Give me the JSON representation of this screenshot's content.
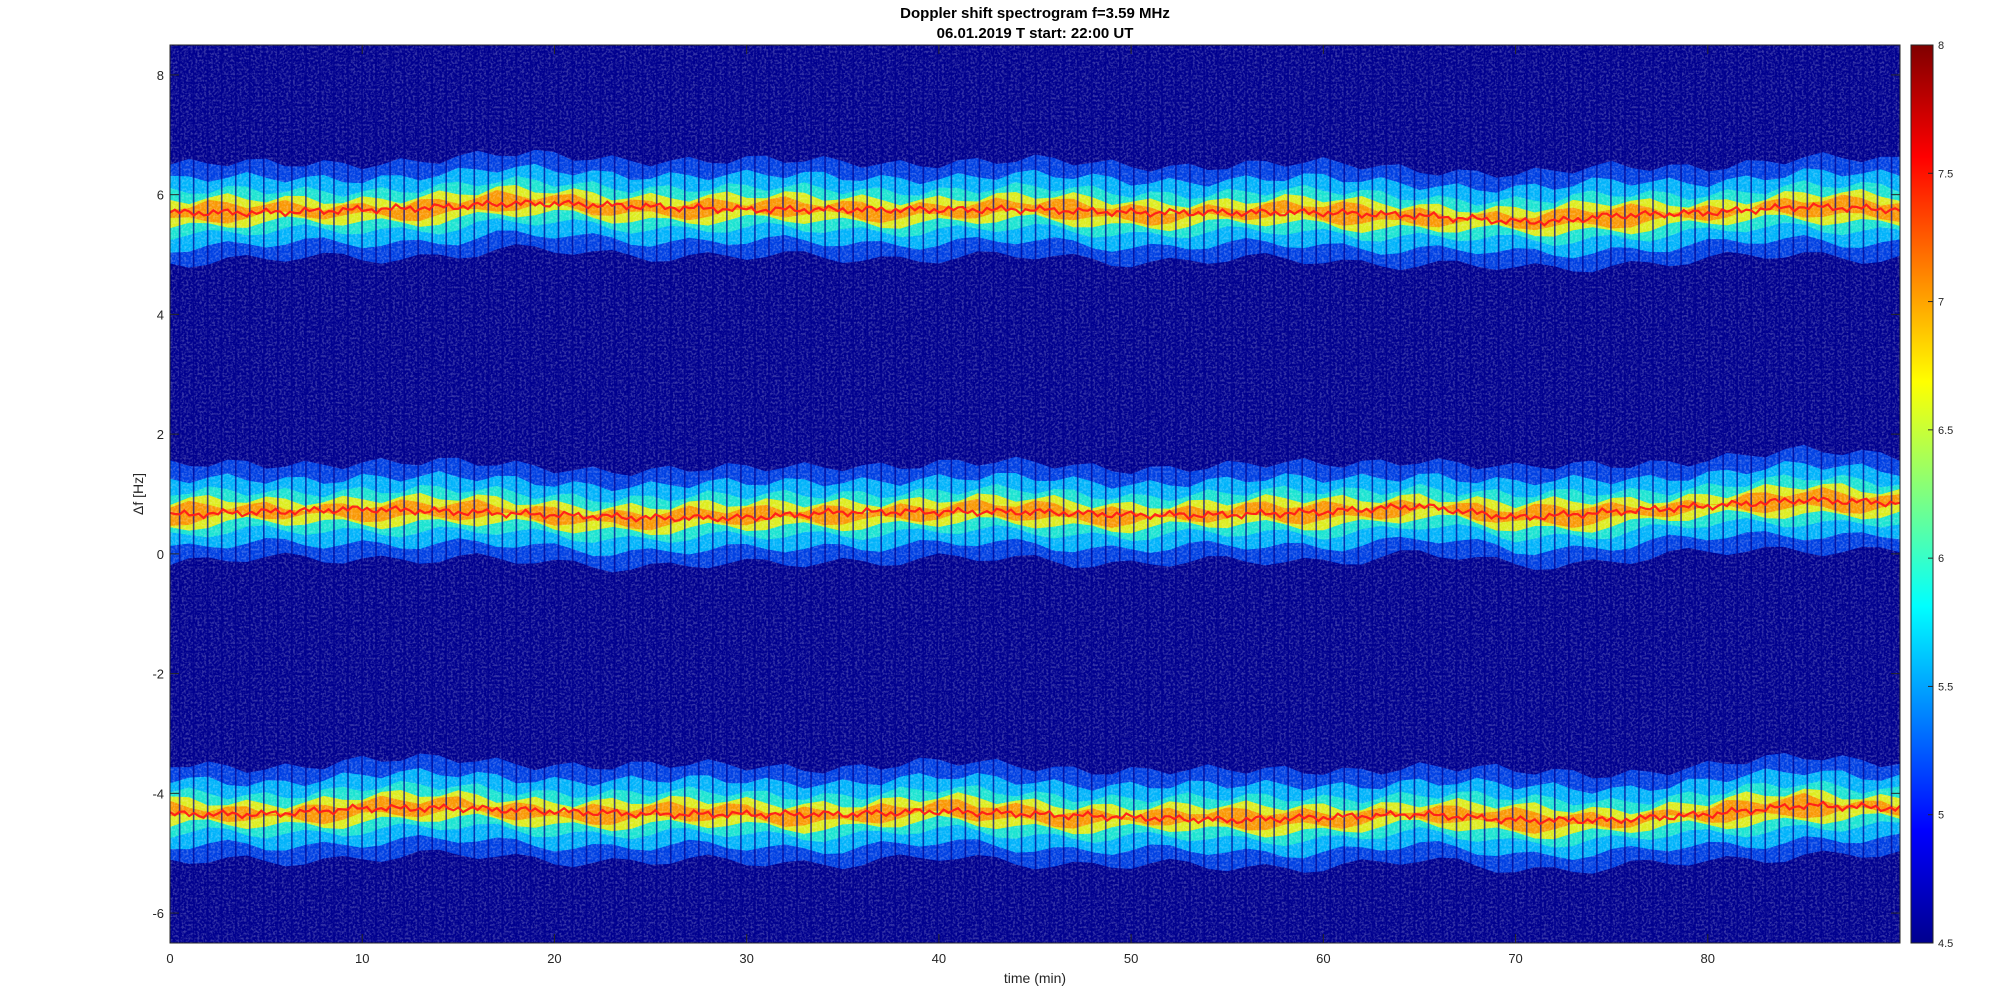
{
  "chart_data": {
    "type": "heatmap",
    "title": "Doppler shift spectrogram f=3.59 MHz",
    "subtitle": "06.01.2019   T start: 22:00 UT",
    "xlabel": "time (min)",
    "ylabel": "Δf [Hz]",
    "xlim": [
      0,
      90
    ],
    "ylim": [
      -6.5,
      8.5
    ],
    "x_ticks": [
      "0",
      "10",
      "20",
      "30",
      "40",
      "50",
      "60",
      "70",
      "80"
    ],
    "y_ticks": [
      "8",
      "6",
      "4",
      "2",
      "0",
      "-2",
      "-4",
      "-6"
    ],
    "colorbar": {
      "range": [
        4.5,
        8
      ],
      "colormap": "jet",
      "ticks": [
        "8",
        "7.5",
        "7",
        "6.5",
        "6",
        "5.5",
        "5",
        "4.5"
      ]
    },
    "series": [
      {
        "time_min": [
          0,
          5,
          10,
          15,
          17,
          20,
          25,
          30,
          35,
          40,
          45,
          50,
          55,
          60,
          65,
          70,
          72,
          75,
          80,
          85,
          90
        ],
        "df_hz": [
          5.7,
          5.7,
          5.75,
          5.8,
          5.85,
          5.85,
          5.8,
          5.75,
          5.75,
          5.75,
          5.75,
          5.7,
          5.7,
          5.7,
          5.65,
          5.55,
          5.55,
          5.65,
          5.7,
          5.8,
          5.75
        ]
      },
      {
        "time_min": [
          0,
          5,
          10,
          15,
          20,
          25,
          30,
          35,
          40,
          45,
          50,
          55,
          60,
          65,
          70,
          75,
          80,
          85,
          90
        ],
        "df_hz": [
          0.65,
          0.7,
          0.75,
          0.7,
          0.65,
          0.6,
          0.6,
          0.7,
          0.7,
          0.7,
          0.65,
          0.65,
          0.7,
          0.8,
          0.6,
          0.7,
          0.8,
          0.9,
          0.85
        ]
      },
      {
        "time_min": [
          0,
          5,
          10,
          15,
          20,
          25,
          30,
          35,
          40,
          45,
          50,
          55,
          60,
          65,
          70,
          75,
          80,
          85,
          90
        ],
        "df_hz": [
          -4.35,
          -4.35,
          -4.25,
          -4.25,
          -4.3,
          -4.35,
          -4.35,
          -4.35,
          -4.3,
          -4.35,
          -4.4,
          -4.45,
          -4.4,
          -4.35,
          -4.45,
          -4.45,
          -4.35,
          -4.2,
          -4.25
        ]
      }
    ]
  }
}
